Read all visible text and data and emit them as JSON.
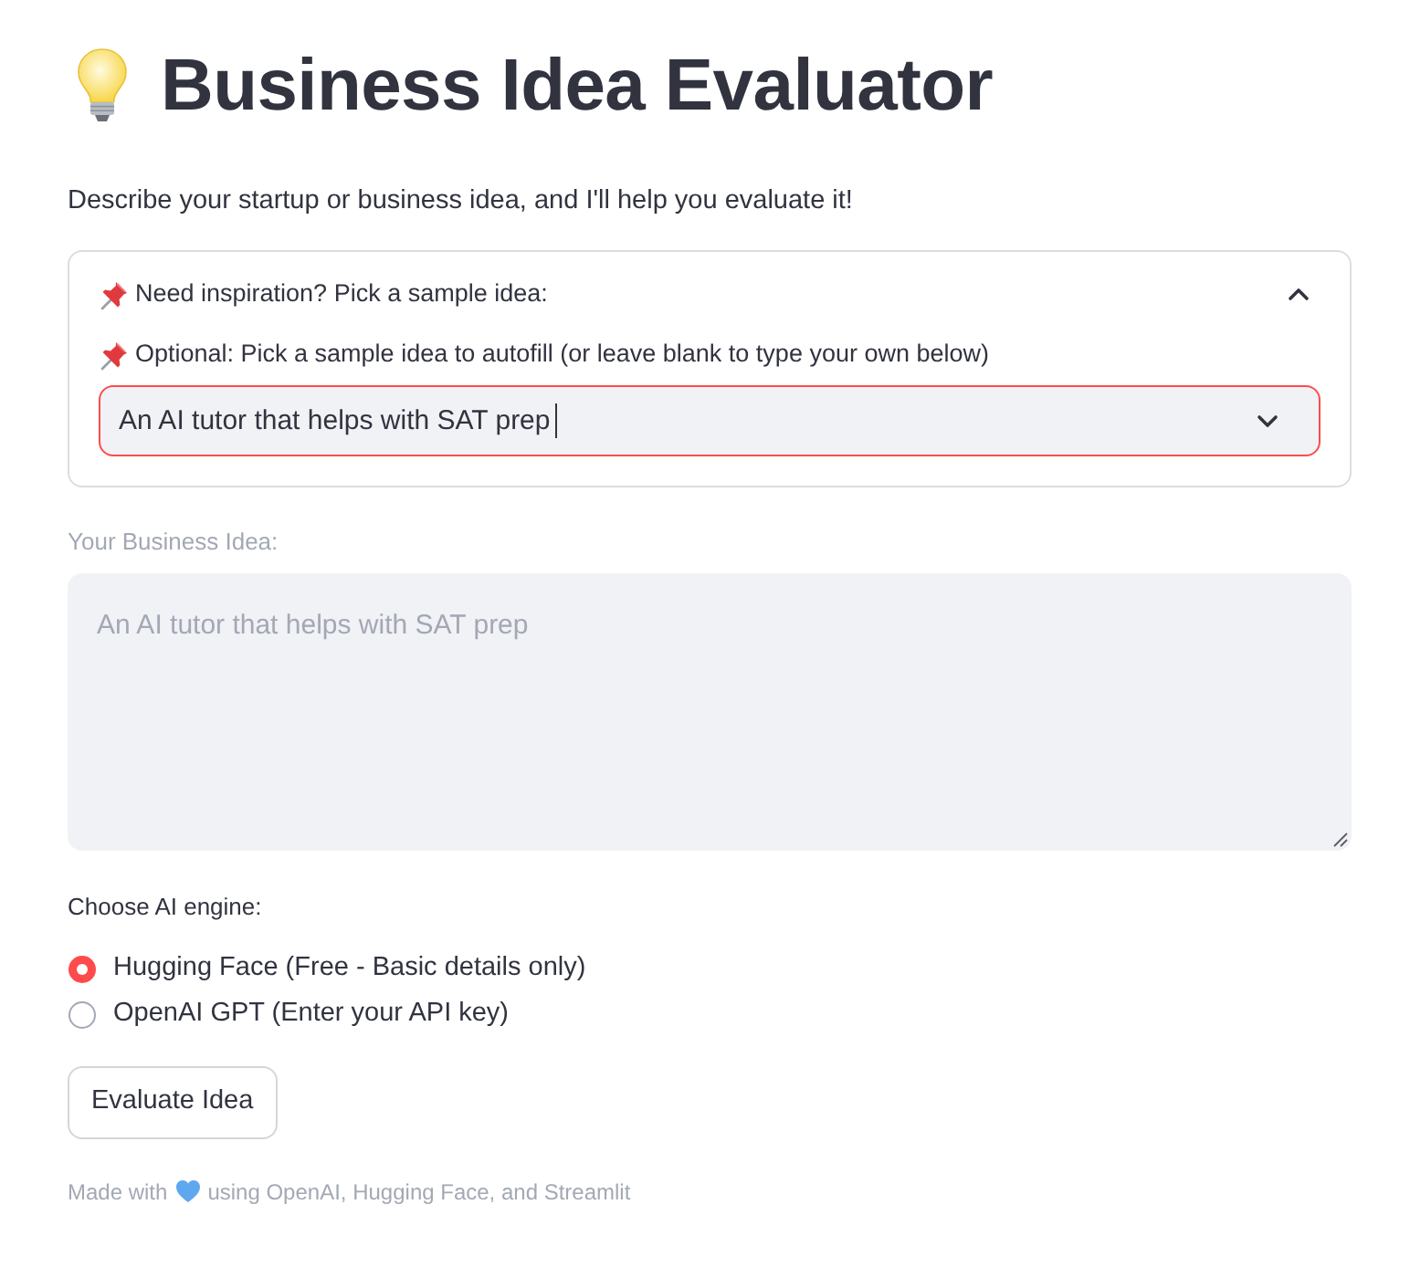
{
  "title": "Business Idea Evaluator",
  "intro": "Describe your startup or business idea, and I'll help you evaluate it!",
  "expander": {
    "title": "Need inspiration? Pick a sample idea:",
    "expanded": true,
    "select_label": "Optional: Pick a sample idea to autofill (or leave blank to type your own below)",
    "select": {
      "value": "An AI tutor that helps with SAT prep",
      "focused": true
    }
  },
  "idea_field": {
    "label": "Your Business Idea:",
    "value": "An AI tutor that helps with SAT prep",
    "disabled": true
  },
  "engine": {
    "label": "Choose AI engine:",
    "options": [
      {
        "label": "Hugging Face (Free - Basic details only)",
        "selected": true
      },
      {
        "label": "OpenAI GPT (Enter your API key)",
        "selected": false
      }
    ]
  },
  "button": "Evaluate Idea",
  "footer": {
    "text_1": "Made with",
    "text_2": "using OpenAI, Hugging Face, and Streamlit"
  }
}
